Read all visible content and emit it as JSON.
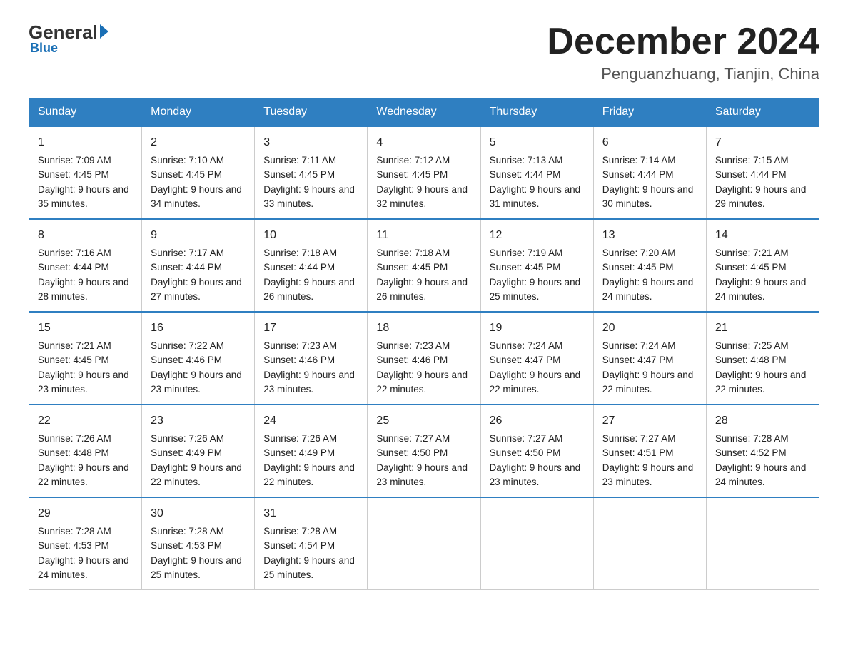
{
  "logo": {
    "general": "General",
    "arrow": "",
    "blue": "Blue"
  },
  "title": "December 2024",
  "location": "Penguanzhuang, Tianjin, China",
  "days_of_week": [
    "Sunday",
    "Monday",
    "Tuesday",
    "Wednesday",
    "Thursday",
    "Friday",
    "Saturday"
  ],
  "weeks": [
    [
      {
        "day": "1",
        "sunrise": "7:09 AM",
        "sunset": "4:45 PM",
        "daylight": "9 hours and 35 minutes."
      },
      {
        "day": "2",
        "sunrise": "7:10 AM",
        "sunset": "4:45 PM",
        "daylight": "9 hours and 34 minutes."
      },
      {
        "day": "3",
        "sunrise": "7:11 AM",
        "sunset": "4:45 PM",
        "daylight": "9 hours and 33 minutes."
      },
      {
        "day": "4",
        "sunrise": "7:12 AM",
        "sunset": "4:45 PM",
        "daylight": "9 hours and 32 minutes."
      },
      {
        "day": "5",
        "sunrise": "7:13 AM",
        "sunset": "4:44 PM",
        "daylight": "9 hours and 31 minutes."
      },
      {
        "day": "6",
        "sunrise": "7:14 AM",
        "sunset": "4:44 PM",
        "daylight": "9 hours and 30 minutes."
      },
      {
        "day": "7",
        "sunrise": "7:15 AM",
        "sunset": "4:44 PM",
        "daylight": "9 hours and 29 minutes."
      }
    ],
    [
      {
        "day": "8",
        "sunrise": "7:16 AM",
        "sunset": "4:44 PM",
        "daylight": "9 hours and 28 minutes."
      },
      {
        "day": "9",
        "sunrise": "7:17 AM",
        "sunset": "4:44 PM",
        "daylight": "9 hours and 27 minutes."
      },
      {
        "day": "10",
        "sunrise": "7:18 AM",
        "sunset": "4:44 PM",
        "daylight": "9 hours and 26 minutes."
      },
      {
        "day": "11",
        "sunrise": "7:18 AM",
        "sunset": "4:45 PM",
        "daylight": "9 hours and 26 minutes."
      },
      {
        "day": "12",
        "sunrise": "7:19 AM",
        "sunset": "4:45 PM",
        "daylight": "9 hours and 25 minutes."
      },
      {
        "day": "13",
        "sunrise": "7:20 AM",
        "sunset": "4:45 PM",
        "daylight": "9 hours and 24 minutes."
      },
      {
        "day": "14",
        "sunrise": "7:21 AM",
        "sunset": "4:45 PM",
        "daylight": "9 hours and 24 minutes."
      }
    ],
    [
      {
        "day": "15",
        "sunrise": "7:21 AM",
        "sunset": "4:45 PM",
        "daylight": "9 hours and 23 minutes."
      },
      {
        "day": "16",
        "sunrise": "7:22 AM",
        "sunset": "4:46 PM",
        "daylight": "9 hours and 23 minutes."
      },
      {
        "day": "17",
        "sunrise": "7:23 AM",
        "sunset": "4:46 PM",
        "daylight": "9 hours and 23 minutes."
      },
      {
        "day": "18",
        "sunrise": "7:23 AM",
        "sunset": "4:46 PM",
        "daylight": "9 hours and 22 minutes."
      },
      {
        "day": "19",
        "sunrise": "7:24 AM",
        "sunset": "4:47 PM",
        "daylight": "9 hours and 22 minutes."
      },
      {
        "day": "20",
        "sunrise": "7:24 AM",
        "sunset": "4:47 PM",
        "daylight": "9 hours and 22 minutes."
      },
      {
        "day": "21",
        "sunrise": "7:25 AM",
        "sunset": "4:48 PM",
        "daylight": "9 hours and 22 minutes."
      }
    ],
    [
      {
        "day": "22",
        "sunrise": "7:26 AM",
        "sunset": "4:48 PM",
        "daylight": "9 hours and 22 minutes."
      },
      {
        "day": "23",
        "sunrise": "7:26 AM",
        "sunset": "4:49 PM",
        "daylight": "9 hours and 22 minutes."
      },
      {
        "day": "24",
        "sunrise": "7:26 AM",
        "sunset": "4:49 PM",
        "daylight": "9 hours and 22 minutes."
      },
      {
        "day": "25",
        "sunrise": "7:27 AM",
        "sunset": "4:50 PM",
        "daylight": "9 hours and 23 minutes."
      },
      {
        "day": "26",
        "sunrise": "7:27 AM",
        "sunset": "4:50 PM",
        "daylight": "9 hours and 23 minutes."
      },
      {
        "day": "27",
        "sunrise": "7:27 AM",
        "sunset": "4:51 PM",
        "daylight": "9 hours and 23 minutes."
      },
      {
        "day": "28",
        "sunrise": "7:28 AM",
        "sunset": "4:52 PM",
        "daylight": "9 hours and 24 minutes."
      }
    ],
    [
      {
        "day": "29",
        "sunrise": "7:28 AM",
        "sunset": "4:53 PM",
        "daylight": "9 hours and 24 minutes."
      },
      {
        "day": "30",
        "sunrise": "7:28 AM",
        "sunset": "4:53 PM",
        "daylight": "9 hours and 25 minutes."
      },
      {
        "day": "31",
        "sunrise": "7:28 AM",
        "sunset": "4:54 PM",
        "daylight": "9 hours and 25 minutes."
      },
      null,
      null,
      null,
      null
    ]
  ],
  "labels": {
    "sunrise": "Sunrise:",
    "sunset": "Sunset:",
    "daylight": "Daylight:"
  }
}
